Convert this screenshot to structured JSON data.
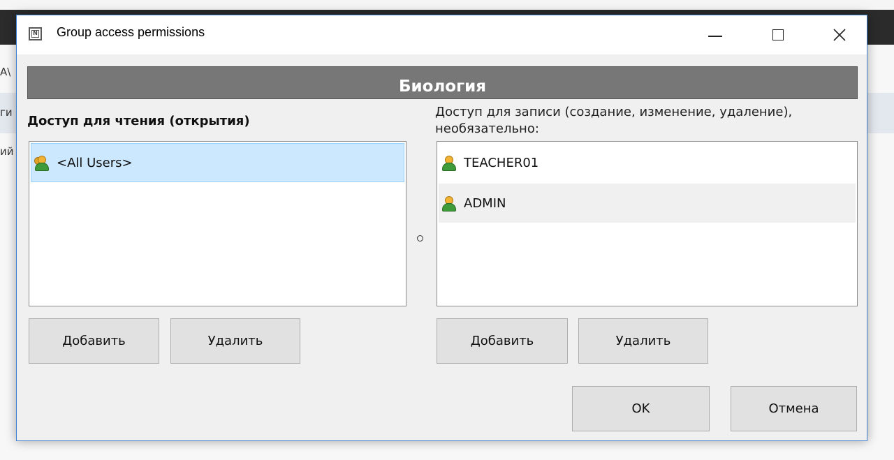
{
  "background": {
    "fragments": [
      "A\\",
      "ги",
      "ий"
    ]
  },
  "window": {
    "title": "Group access permissions",
    "controls": {
      "minimize": "minimize",
      "maximize": "maximize",
      "close": "close"
    }
  },
  "header": {
    "group_name": "Биология"
  },
  "read_access": {
    "label": "Доступ для чтения (открытия)",
    "items": [
      {
        "name": "<All Users>",
        "icon": "user-group-icon",
        "selected": true
      }
    ],
    "add_label": "Добавить",
    "remove_label": "Удалить"
  },
  "write_access": {
    "label": "Доступ для записи (создание, изменение, удаление), необязательно:",
    "items": [
      {
        "name": "TEACHER01",
        "icon": "user-icon"
      },
      {
        "name": "ADMIN",
        "icon": "user-icon"
      }
    ],
    "add_label": "Добавить",
    "remove_label": "Удалить"
  },
  "footer": {
    "ok_label": "OK",
    "cancel_label": "Отмена"
  },
  "colors": {
    "header_bg": "#777777",
    "selection": "#cce8ff",
    "window_border": "#3a7fd0"
  }
}
